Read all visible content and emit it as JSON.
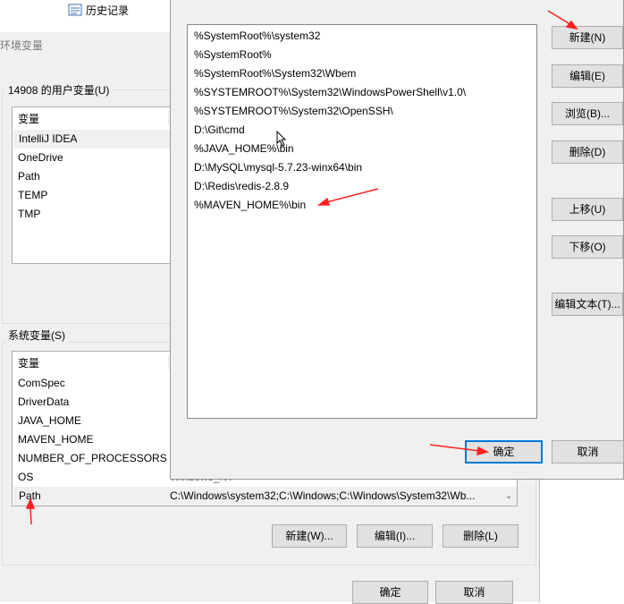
{
  "explorer": {
    "history_label": "历史记录"
  },
  "env_dialog": {
    "title": "环境变量",
    "user_group_label": "14908 的用户变量(U)",
    "user_col_header": "变量",
    "user_vars": [
      "IntelliJ IDEA",
      "OneDrive",
      "Path",
      "TEMP",
      "TMP"
    ],
    "sys_group_label": "系统变量(S)",
    "sys_col_header": "变量",
    "sys_vars": [
      "ComSpec",
      "DriverData",
      "JAVA_HOME",
      "MAVEN_HOME",
      "NUMBER_OF_PROCESSORS",
      "OS",
      "Path"
    ],
    "os_value_fragment": "Windows_NT",
    "path_value": "C:\\Windows\\system32;C:\\Windows;C:\\Windows\\System32\\Wb...",
    "new_button": "新建(W)...",
    "edit_button": "编辑(I)...",
    "delete_button": "删除(L)",
    "ok_button": "确定",
    "cancel_button": "取消"
  },
  "edit_dialog": {
    "paths": [
      "%SystemRoot%\\system32",
      "%SystemRoot%",
      "%SystemRoot%\\System32\\Wbem",
      "%SYSTEMROOT%\\System32\\WindowsPowerShell\\v1.0\\",
      "%SYSTEMROOT%\\System32\\OpenSSH\\",
      "D:\\Git\\cmd",
      "%JAVA_HOME%\\bin",
      "D:\\MySQL\\mysql-5.7.23-winx64\\bin",
      "D:\\Redis\\redis-2.8.9",
      "%MAVEN_HOME%\\bin"
    ],
    "new_button": "新建(N)",
    "edit_button": "编辑(E)",
    "browse_button": "浏览(B)...",
    "delete_button": "删除(D)",
    "move_up_button": "上移(U)",
    "move_down_button": "下移(O)",
    "edit_text_button": "编辑文本(T)...",
    "ok_button": "确定",
    "cancel_button": "取消"
  },
  "colors": {
    "annotation_arrow": "#ff2020",
    "focus_border": "#0078d7"
  }
}
